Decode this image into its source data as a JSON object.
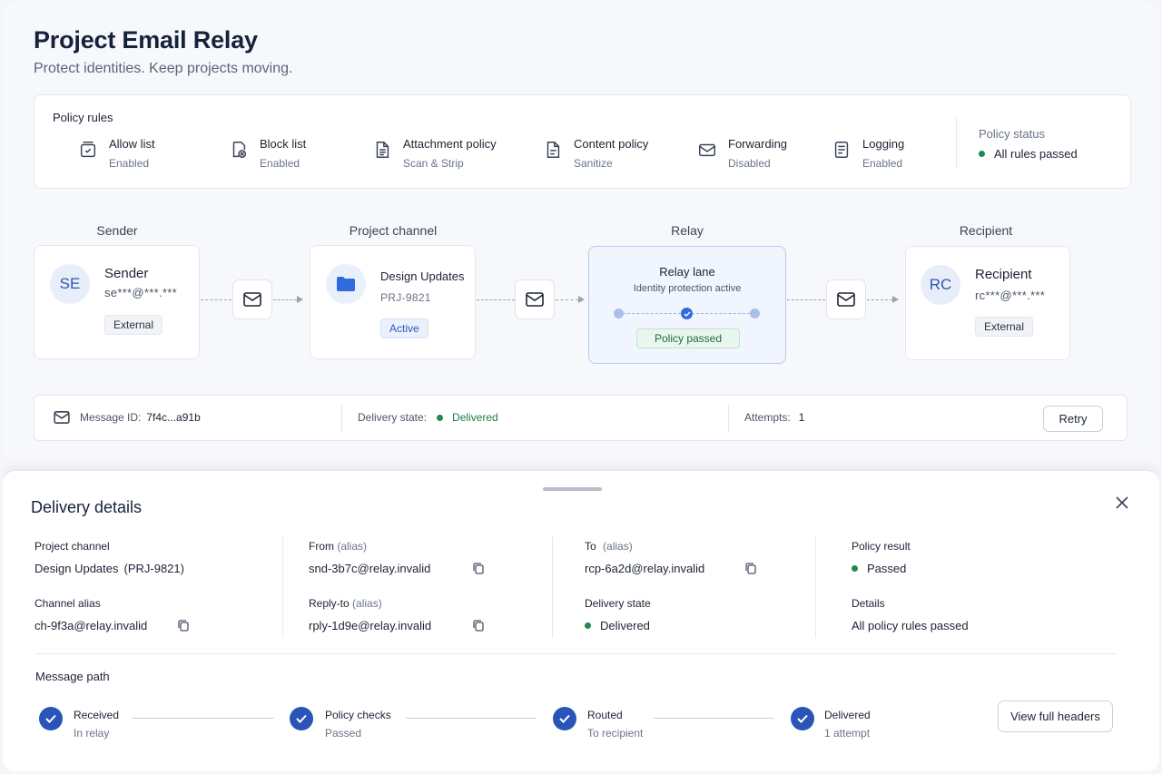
{
  "header": {
    "title": "Project Email Relay",
    "subtitle": "Protect identities. Keep projects moving."
  },
  "policy": {
    "heading": "Policy rules",
    "rules": [
      {
        "icon": "inbox-check-icon",
        "title": "Allow list",
        "status": "Enabled"
      },
      {
        "icon": "block-list-icon",
        "title": "Block list",
        "status": "Enabled"
      },
      {
        "icon": "attachment-doc-icon",
        "title": "Attachment policy",
        "status": "Scan & Strip"
      },
      {
        "icon": "content-doc-icon",
        "title": "Content policy",
        "status": "Sanitize"
      },
      {
        "icon": "mail-forward-icon",
        "title": "Forwarding",
        "status": "Disabled"
      },
      {
        "icon": "log-doc-icon",
        "title": "Logging",
        "status": "Enabled"
      }
    ],
    "status_label": "Policy status",
    "status_value": "All rules passed",
    "status_color": "#1e8a4f"
  },
  "flow": {
    "sender": {
      "label": "Sender",
      "initials": "SE",
      "name": "Sender",
      "email": "se***@***.***",
      "tag": "External"
    },
    "channel": {
      "label": "Project channel",
      "name": "Design Updates",
      "id": "PRJ-9821",
      "tag": "Active"
    },
    "relay": {
      "label": "Relay",
      "name": "Relay lane",
      "desc": "Identity protection active",
      "tag": "Policy passed"
    },
    "recipient": {
      "label": "Recipient",
      "initials": "RC",
      "name": "Recipient",
      "email": "rc***@***.***",
      "tag": "External"
    }
  },
  "message": {
    "id_label": "Message ID:",
    "id_value": "7f4c...a91b",
    "state_label": "Delivery state:",
    "state_value": "Delivered",
    "attempts_label": "Attempts:",
    "attempts_value": "1",
    "retry_label": "Retry"
  },
  "details": {
    "title": "Delivery details",
    "project_channel_label": "Project channel",
    "project_channel_name": "Design Updates",
    "project_channel_id": "(PRJ-9821)",
    "channel_alias_label": "Channel alias",
    "channel_alias_value": "ch-9f3a@relay.invalid",
    "from_label": "From",
    "from_note": "(alias)",
    "from_value": "snd-3b7c@relay.invalid",
    "reply_label": "Reply-to",
    "reply_note": "(alias)",
    "reply_value": "rply-1d9e@relay.invalid",
    "to_label": "To",
    "to_note": "(alias)",
    "to_value": "rcp-6a2d@relay.invalid",
    "state_label": "Delivery state",
    "state_value": "Delivered",
    "policy_result_label": "Policy result",
    "policy_result_value": "Passed",
    "details_label": "Details",
    "details_value": "All policy rules passed",
    "path_title": "Message path",
    "steps": [
      {
        "title": "Received",
        "sub": "In relay"
      },
      {
        "title": "Policy checks",
        "sub": "Passed"
      },
      {
        "title": "Routed",
        "sub": "To recipient"
      },
      {
        "title": "Delivered",
        "sub": "1 attempt"
      }
    ],
    "view_headers_label": "View full headers"
  },
  "colors": {
    "accent": "#2a55b8",
    "success": "#1e8a4f"
  }
}
